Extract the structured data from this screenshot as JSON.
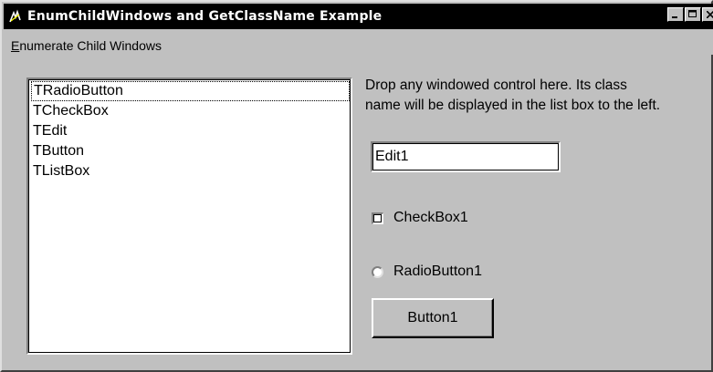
{
  "window": {
    "title": "EnumChildWindows and GetClassName Example",
    "caption_buttons": [
      "minimize-icon",
      "maximize-icon",
      "close-icon"
    ]
  },
  "menu": {
    "items": [
      {
        "label_rest": "numerate Child Windows",
        "label_underlined": "E"
      }
    ]
  },
  "list": {
    "items": [
      "TRadioButton",
      "TCheckBox",
      "TEdit",
      "TButton",
      "TListBox"
    ],
    "focused_index": 0
  },
  "instructions": {
    "line1": "Drop any windowed control here. Its class",
    "line2": "name will be displayed in the list box to the left."
  },
  "edit": {
    "value": "Edit1"
  },
  "checkbox": {
    "label": "CheckBox1",
    "checked": false
  },
  "radio": {
    "label": "RadioButton1",
    "checked": false
  },
  "button": {
    "label": "Button1"
  },
  "colors": {
    "face": "#c0c0c0",
    "titlebar": "#000000",
    "window_bg": "#ffffff"
  }
}
